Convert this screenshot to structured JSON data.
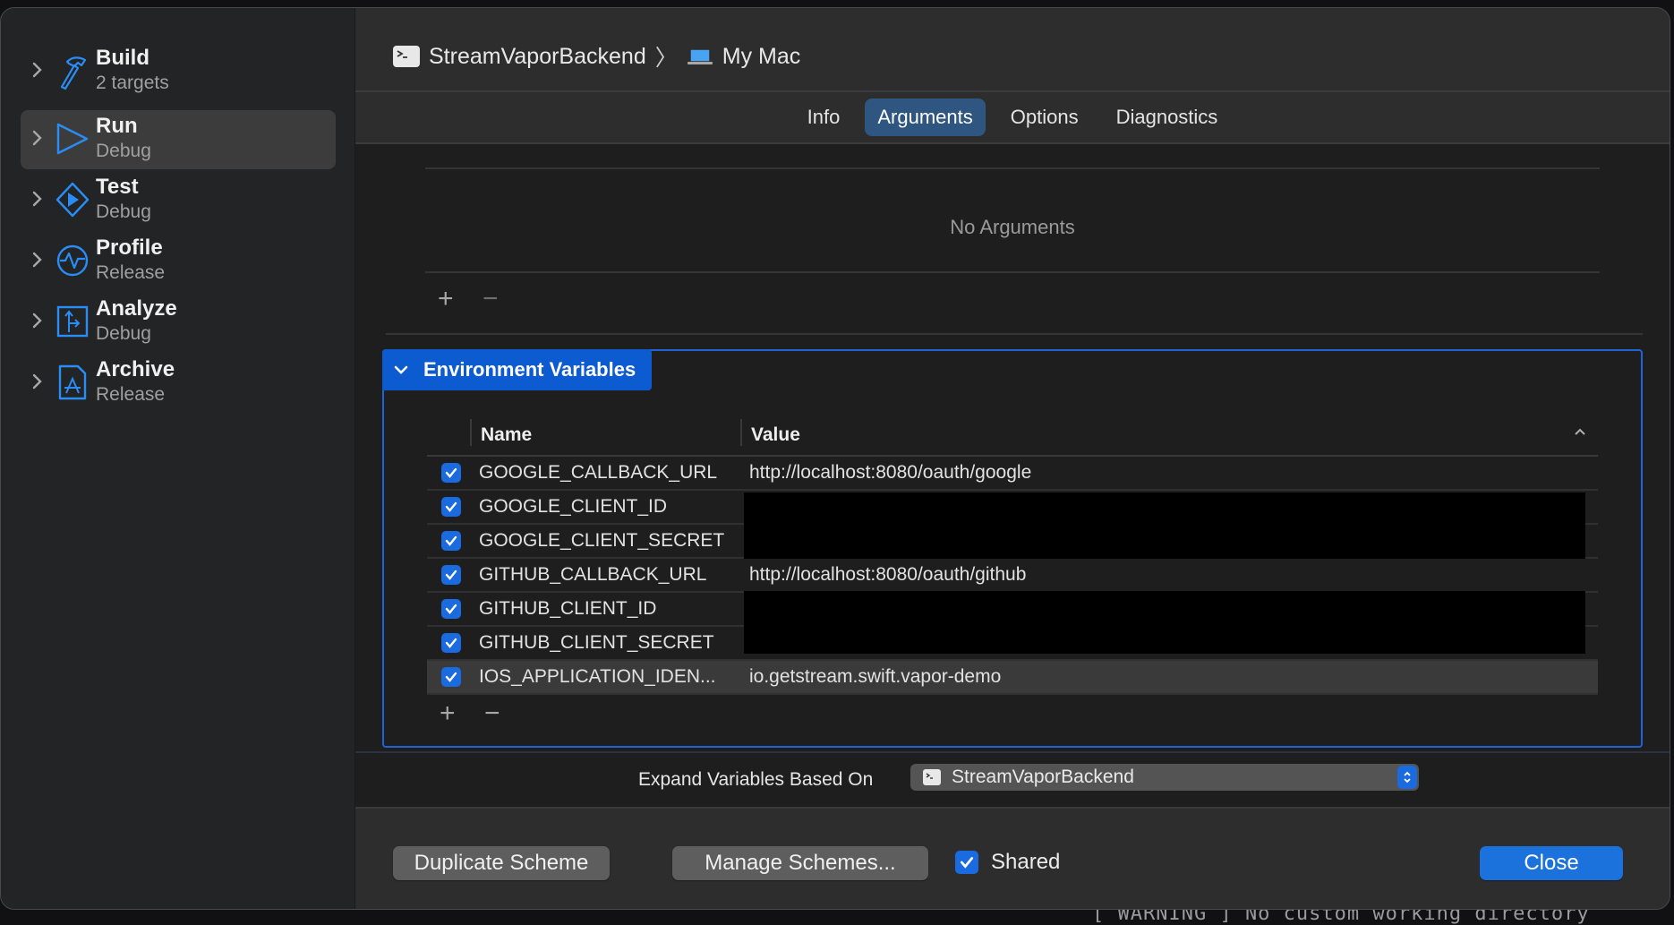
{
  "background_terminal": "[ WARNING ] No custom working directory",
  "sidebar": {
    "items": [
      {
        "title": "Build",
        "subtitle": "2 targets",
        "icon": "hammer-icon",
        "selected": false
      },
      {
        "title": "Run",
        "subtitle": "Debug",
        "icon": "play-outline-icon",
        "selected": true
      },
      {
        "title": "Test",
        "subtitle": "Debug",
        "icon": "test-diamond-icon",
        "selected": false
      },
      {
        "title": "Profile",
        "subtitle": "Release",
        "icon": "profile-waveform-icon",
        "selected": false
      },
      {
        "title": "Analyze",
        "subtitle": "Debug",
        "icon": "analyze-branch-icon",
        "selected": false
      },
      {
        "title": "Archive",
        "subtitle": "Release",
        "icon": "archive-appstore-icon",
        "selected": false
      }
    ]
  },
  "header": {
    "scheme": "StreamVaporBackend",
    "separator": "〉",
    "destination": "My Mac"
  },
  "tabs": [
    {
      "label": "Info",
      "active": false
    },
    {
      "label": "Arguments",
      "active": true
    },
    {
      "label": "Options",
      "active": false
    },
    {
      "label": "Diagnostics",
      "active": false
    }
  ],
  "arguments": {
    "empty_text": "No Arguments",
    "add": "+",
    "remove": "−"
  },
  "env": {
    "title": "Environment Variables",
    "columns": {
      "name": "Name",
      "value": "Value"
    },
    "rows": [
      {
        "name": "GOOGLE_CALLBACK_URL",
        "value": "http://localhost:8080/oauth/google",
        "checked": true,
        "redacted": false
      },
      {
        "name": "GOOGLE_CLIENT_ID",
        "value": "",
        "checked": true,
        "redacted": true
      },
      {
        "name": "GOOGLE_CLIENT_SECRET",
        "value": "",
        "checked": true,
        "redacted": true
      },
      {
        "name": "GITHUB_CALLBACK_URL",
        "value": "http://localhost:8080/oauth/github",
        "checked": true,
        "redacted": false
      },
      {
        "name": "GITHUB_CLIENT_ID",
        "value": "",
        "checked": true,
        "redacted": true
      },
      {
        "name": "GITHUB_CLIENT_SECRET",
        "value": "",
        "checked": true,
        "redacted": true
      },
      {
        "name": "IOS_APPLICATION_IDEN...",
        "value": "io.getstream.swift.vapor-demo",
        "checked": true,
        "redacted": false,
        "selected": true
      }
    ],
    "add": "+",
    "remove": "−"
  },
  "expand": {
    "label": "Expand Variables Based On",
    "selected": "StreamVaporBackend"
  },
  "footer": {
    "duplicate": "Duplicate Scheme",
    "manage": "Manage Schemes...",
    "shared_label": "Shared",
    "shared_checked": true,
    "close": "Close"
  },
  "colors": {
    "accent": "#1a6ae0",
    "tab_active": "#2f5680",
    "env_header": "#0d5bd1"
  }
}
